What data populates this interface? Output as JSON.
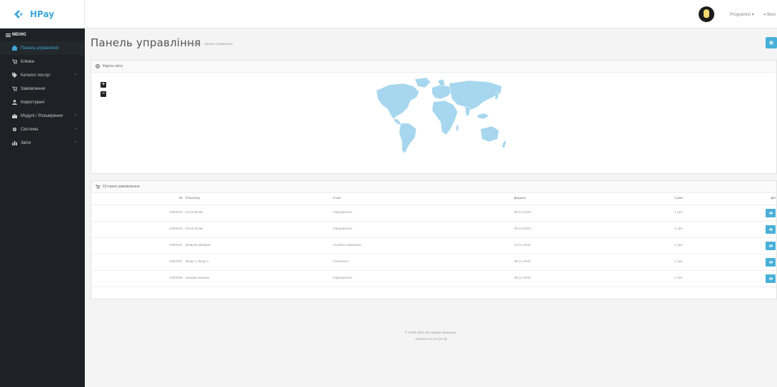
{
  "header": {
    "brand": "HPay",
    "user_menu": "Programist ▾",
    "logout": "⇥ Вихі"
  },
  "sidebar": {
    "menu_label": "МЕНЮ",
    "items": [
      {
        "label": "Панель управління",
        "icon": "dashboard-icon",
        "active": true,
        "has_arrow": false
      },
      {
        "label": "Клініки",
        "icon": "cart-icon",
        "active": false,
        "has_arrow": false
      },
      {
        "label": "Каталог послуг",
        "icon": "tag-icon",
        "active": false,
        "has_arrow": true
      },
      {
        "label": "Замовлення",
        "icon": "cart-icon",
        "active": false,
        "has_arrow": false
      },
      {
        "label": "Користувачі",
        "icon": "user-icon",
        "active": false,
        "has_arrow": false
      },
      {
        "label": "Модулі / Розширення",
        "icon": "puzzle-icon",
        "active": false,
        "has_arrow": true
      },
      {
        "label": "Система",
        "icon": "gear-icon",
        "active": false,
        "has_arrow": true
      },
      {
        "label": "Звіти",
        "icon": "bar-chart-icon",
        "active": false,
        "has_arrow": true
      }
    ]
  },
  "main": {
    "title": "Панель управління",
    "breadcrumb": [
      "Головна",
      "Панель управління"
    ],
    "map_panel": {
      "title": "Карта світу",
      "zoom_in": "+",
      "zoom_out": "−"
    },
    "orders": {
      "title": "Останні замовлення",
      "columns": [
        "№",
        "Покупець",
        "Стан",
        "Додано",
        "Сума",
        "Дія"
      ],
      "rows": [
        {
          "id": "1000044",
          "customer": "Неля Білик",
          "status": "Оформлено",
          "date": "08.12.2022",
          "sum": "1 грн."
        },
        {
          "id": "1000043",
          "customer": "Неля Білик",
          "status": "Оформлено",
          "date": "08.12.2022",
          "sum": "1 грн."
        },
        {
          "id": "1000041",
          "customer": "фиврие фиврие",
          "status": "Успішно виконано",
          "date": "14.11.2022",
          "sum": "1 грн."
        },
        {
          "id": "1000037",
          "customer": "Лікар 1 Лікар 1",
          "status": "Оплачено",
          "date": "09.11.2022",
          "sum": "1 грн."
        },
        {
          "id": "1000036",
          "customer": "ииииии ииииии",
          "status": "Оформлено",
          "date": "09.11.2022",
          "sum": "1 грн."
        }
      ]
    }
  },
  "footer": {
    "copyright": "© 2009-2022 Всі права захищені.",
    "version": "Version 3.0.3.6 (rs-3)"
  },
  "colors": {
    "accent": "#48b0d8",
    "sidebar_bg": "#1e2125",
    "map_land": "#a6d7ee"
  }
}
